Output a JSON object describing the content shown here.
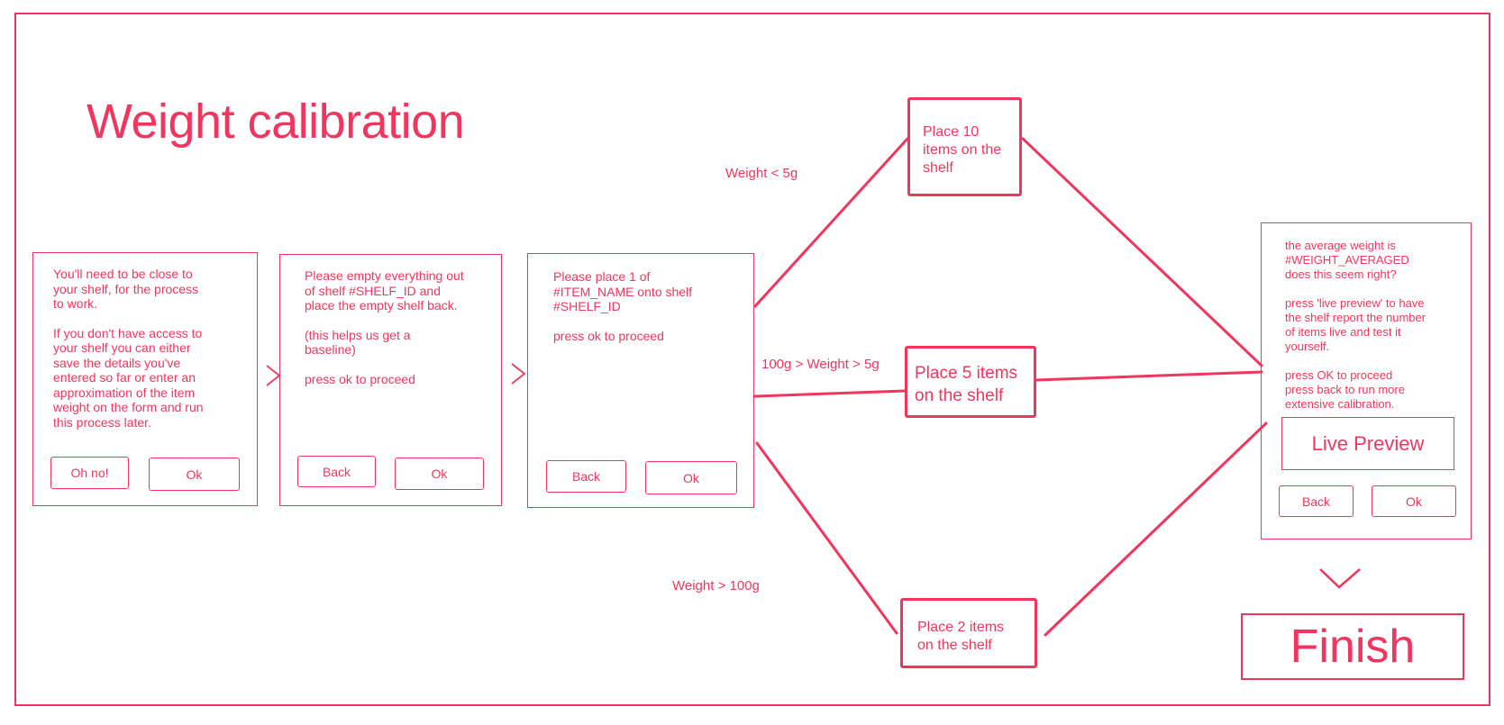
{
  "title": "Weight calibration",
  "accent_color": "#f0365f",
  "cards": [
    {
      "paragraphs": [
        "You'll need to be close to\nyour shelf, for the process\nto work.",
        "If you don't have access to\nyour shelf you can either\nsave the details you've\nentered so far or enter an\napproximation of the item\nweight on the form and run\nthis process later."
      ],
      "buttons": [
        "Oh no!",
        "Ok"
      ]
    },
    {
      "paragraphs": [
        "Please empty everything out\nof shelf #SHELF_ID and\nplace the empty shelf back.",
        "(this helps us get a\nbaseline)",
        "press ok to proceed"
      ],
      "buttons": [
        "Back",
        "Ok"
      ]
    },
    {
      "paragraphs": [
        "Please place 1 of\n#ITEM_NAME onto shelf\n#SHELF_ID",
        "press ok to proceed"
      ],
      "buttons": [
        "Back",
        "Ok"
      ]
    },
    {
      "paragraphs": [
        "the average weight is\n#WEIGHT_AVERAGED\ndoes this seem right?",
        "press 'live preview' to have\nthe shelf report the number\nof items live and test it\nyourself.",
        "press OK to proceed\npress back to run more\nextensive calibration."
      ],
      "live_preview": "Live Preview",
      "buttons": [
        "Back",
        "Ok"
      ]
    }
  ],
  "branches": [
    {
      "condition": "Weight < 5g",
      "action": "Place 10\nitems on the\nshelf"
    },
    {
      "condition": "100g > Weight > 5g",
      "action": "Place 5 items\non the shelf"
    },
    {
      "condition": "Weight > 100g",
      "action": "Place 2 items\non the shelf"
    }
  ],
  "finish": "Finish"
}
